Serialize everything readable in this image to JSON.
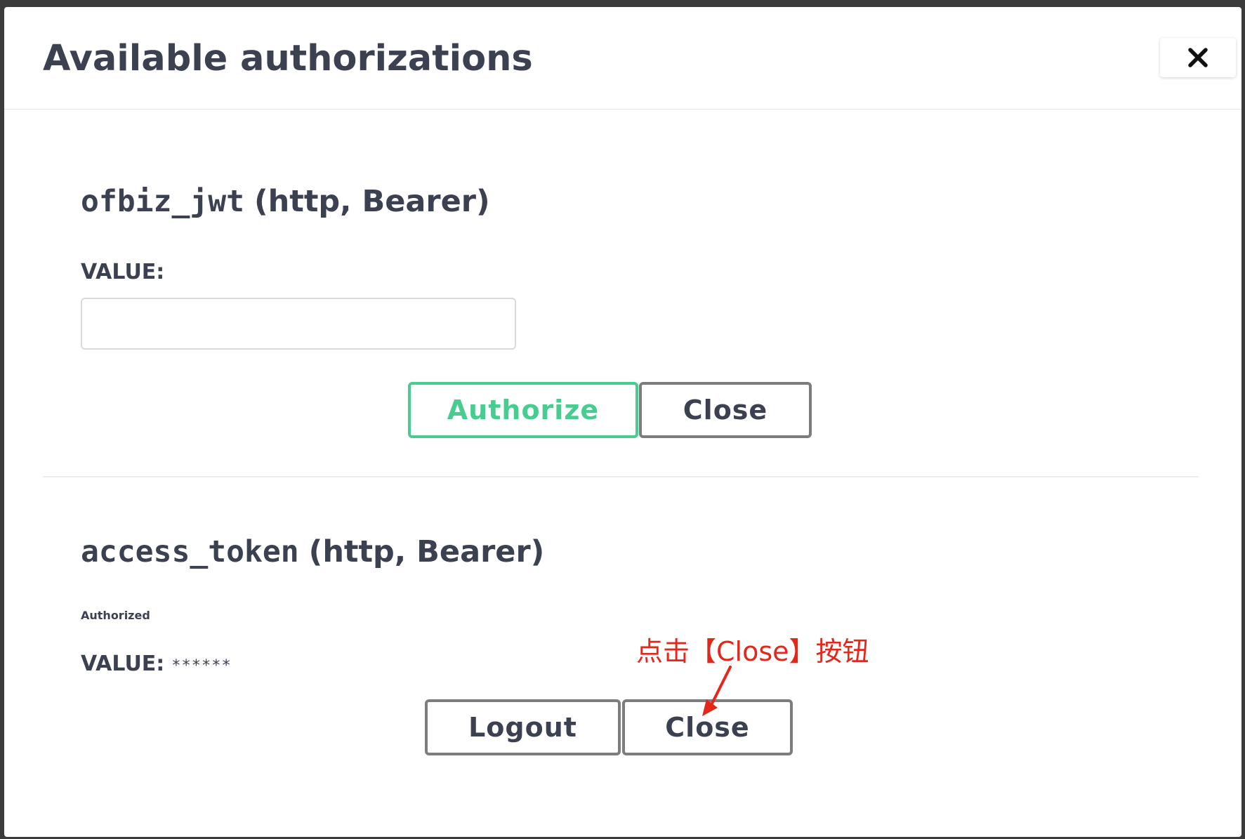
{
  "dialog": {
    "title": "Available authorizations",
    "close_icon": "close-icon"
  },
  "schemes": [
    {
      "name": "ofbiz_jwt",
      "meta": "(http, Bearer)",
      "value_label": "VALUE:",
      "value_input": "",
      "authorize_label": "Authorize",
      "close_label": "Close"
    },
    {
      "name": "access_token",
      "meta": "(http, Bearer)",
      "status": "Authorized",
      "value_label": "VALUE:",
      "masked_value": "******",
      "logout_label": "Logout",
      "close_label": "Close"
    }
  ],
  "annotation": {
    "text": "点击【Close】按钮",
    "color": "#e4271b"
  },
  "colors": {
    "heading": "#3b4151",
    "authorize": "#49cc90",
    "button_border": "#7d7d7d"
  }
}
